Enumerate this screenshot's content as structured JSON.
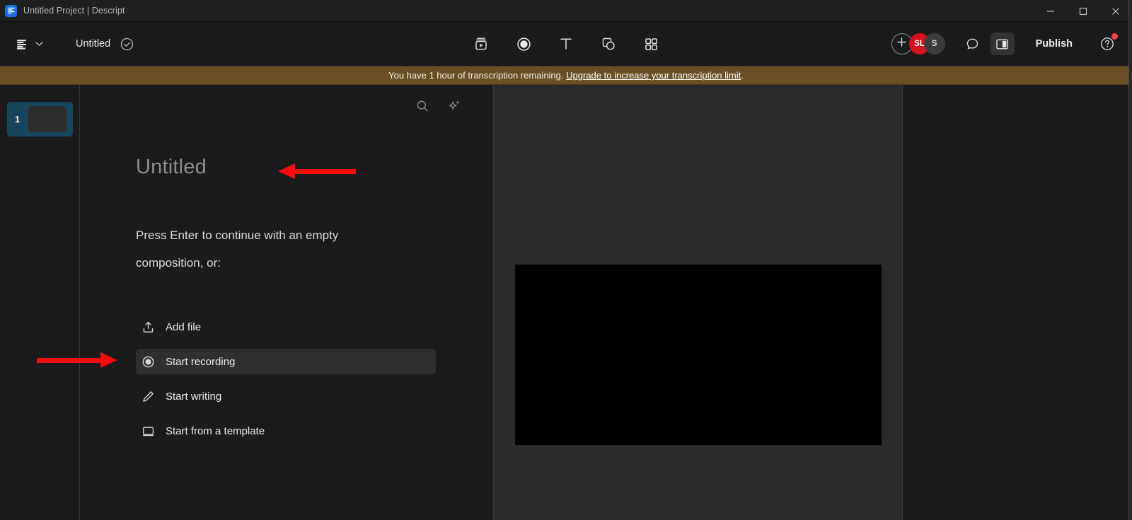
{
  "window": {
    "title": "Untitled Project | Descript",
    "app_icon": "descript-logo-icon",
    "controls": {
      "minimize": "minimize-icon",
      "maximize": "maximize-icon",
      "close": "close-icon"
    }
  },
  "toolbar": {
    "app_menu_icon": "descript-menu-icon",
    "app_menu_chevron": "chevron-down-icon",
    "document_name": "Untitled",
    "saved_status_icon": "check-circle-icon",
    "center_tools": [
      {
        "name": "media-clip-icon",
        "label": "Media"
      },
      {
        "name": "record-icon",
        "label": "Record"
      },
      {
        "name": "text-icon",
        "label": "Text"
      },
      {
        "name": "shapes-icon",
        "label": "Shapes"
      },
      {
        "name": "apps-grid-icon",
        "label": "Apps"
      }
    ],
    "add_button_icon": "plus-icon",
    "avatars": [
      {
        "initials": "SL",
        "color": "#d3121c"
      },
      {
        "initials": "S",
        "color": "#3c3c3c"
      }
    ],
    "comment_icon": "comment-bubble-icon",
    "panel_toggle_icon": "side-panel-icon",
    "publish_label": "Publish",
    "help_icon": "help-circle-icon",
    "help_badge": true
  },
  "banner": {
    "message": "You have 1 hour of transcription remaining.",
    "link_text": "Upgrade to increase your transcription limit",
    "suffix": ".",
    "background": "#6b4f22"
  },
  "scenes": {
    "items": [
      {
        "number": "1",
        "selected": true
      }
    ],
    "selected_color": "#17455e"
  },
  "document": {
    "tools": [
      {
        "name": "search-icon",
        "label": "Search"
      },
      {
        "name": "ai-sparkle-icon",
        "label": "AI actions"
      }
    ],
    "title_placeholder": "Untitled",
    "prompt": "Press Enter to continue with an empty composition, or:",
    "actions": [
      {
        "icon": "upload-icon",
        "label": "Add file",
        "hovered": false
      },
      {
        "icon": "record-circle-icon",
        "label": "Start recording",
        "hovered": true
      },
      {
        "icon": "pencil-icon",
        "label": "Start writing",
        "hovered": false
      },
      {
        "icon": "template-screen-icon",
        "label": "Start from a template",
        "hovered": false
      }
    ]
  },
  "preview": {
    "canvas_color": "#000000",
    "background": "#2b2b2b"
  },
  "annotations": [
    {
      "name": "arrow-to-title",
      "direction": "left",
      "color": "#fb0b0b"
    },
    {
      "name": "arrow-to-start-recording",
      "direction": "right",
      "color": "#fb0b0b"
    }
  ]
}
